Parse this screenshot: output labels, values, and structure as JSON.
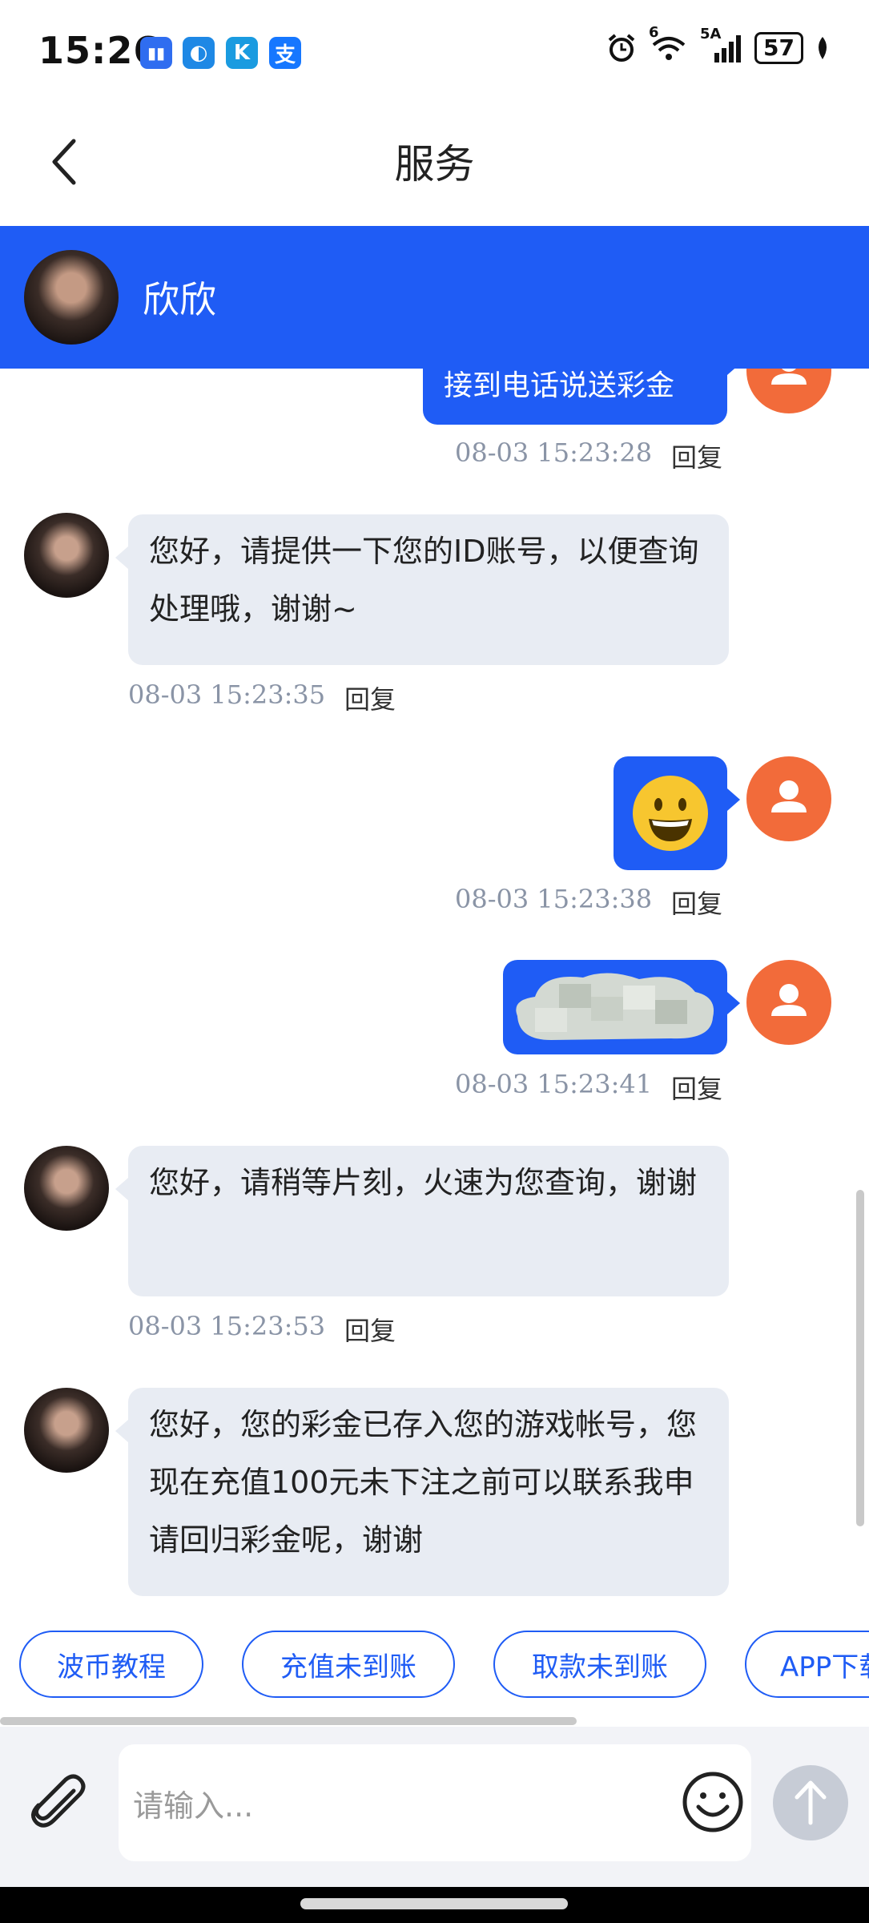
{
  "status_bar": {
    "time": "15:26",
    "app_icons": [
      "▮▮",
      "◐",
      "K",
      "支"
    ],
    "network": "5A",
    "wifi_badge": "6",
    "battery": "57"
  },
  "header": {
    "title": "服务"
  },
  "agent": {
    "name": "欣欣"
  },
  "messages": [
    {
      "from": "user",
      "text": "接到电话说送彩金",
      "time": "08-03 15:23:28",
      "reply": "回复"
    },
    {
      "from": "agent",
      "text": "您好，请提供一下您的ID账号，以便查询处理哦，谢谢~",
      "time": "08-03 15:23:35",
      "reply": "回复"
    },
    {
      "from": "user",
      "emoji": "😃",
      "time": "08-03 15:23:38",
      "reply": "回复"
    },
    {
      "from": "user",
      "image": "blurred-image",
      "time": "08-03 15:23:41",
      "reply": "回复"
    },
    {
      "from": "agent",
      "text": "您好，请稍等片刻，火速为您查询，谢谢",
      "time": "08-03 15:23:53",
      "reply": "回复"
    },
    {
      "from": "agent",
      "text": "您好，您的彩金已存入您的游戏帐号，您现在充值100元未下注之前可以联系我申请回归彩金呢，谢谢"
    }
  ],
  "quick_replies": [
    "波币教程",
    "充值未到账",
    "取款未到账",
    "APP下载"
  ],
  "input": {
    "placeholder": "请输入..."
  },
  "colors": {
    "brand": "#1f5cf5",
    "user_avatar": "#f26b3a",
    "agent_bubble": "#e8ecf3"
  },
  "icons": [
    "back-icon",
    "user-icon",
    "attach-icon",
    "emoji-icon",
    "send-arrow-icon"
  ]
}
